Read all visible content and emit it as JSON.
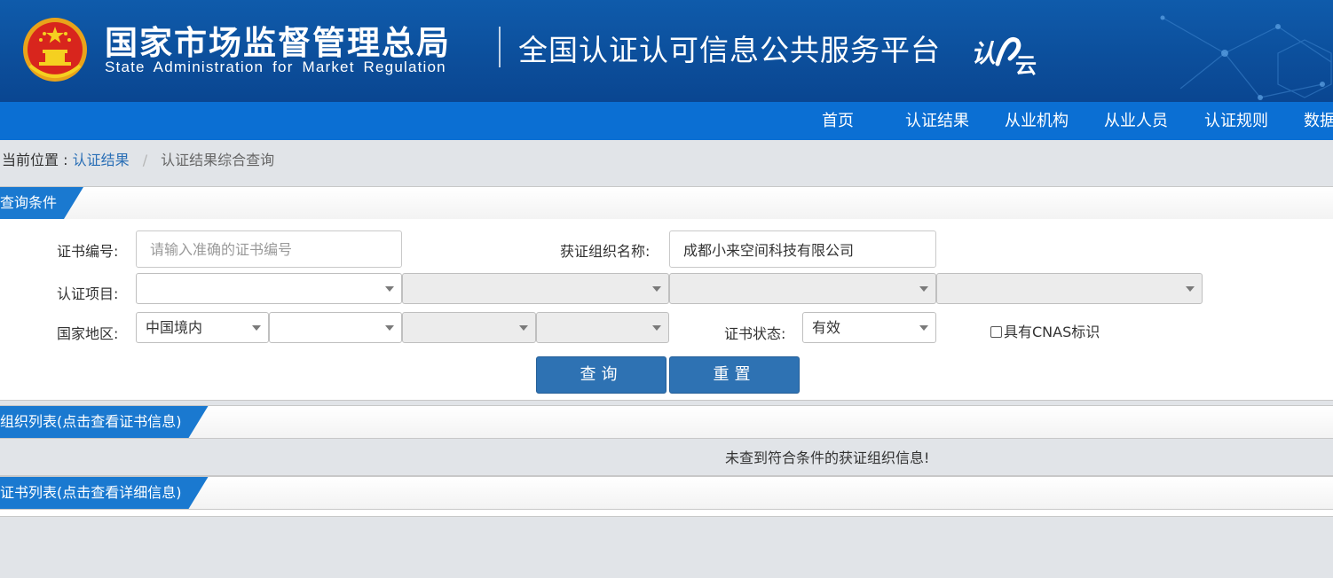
{
  "header": {
    "agency_cn": "国家市场监督管理总局",
    "agency_en": "State Administration for Market Regulation",
    "platform_title": "全国认证认可信息公共服务平台",
    "logo_text": "认证云",
    "emblem_icon": "national-emblem-icon"
  },
  "nav": {
    "items": [
      "首页",
      "认证结果",
      "从业机构",
      "从业人员",
      "认证规则",
      "数据"
    ]
  },
  "breadcrumb": {
    "prefix": "当前位置 :",
    "link": "认证结果",
    "separator": "/",
    "current": "认证结果综合查询"
  },
  "query_panel": {
    "title": "查询条件",
    "cert_no_label": "证书编号:",
    "cert_no_placeholder": "请输入准确的证书编号",
    "cert_no_value": "",
    "org_name_label": "获证组织名称:",
    "org_name_value": "成都小来空间科技有限公司",
    "project_label": "认证项目:",
    "project_selects": [
      "",
      "",
      "",
      ""
    ],
    "region_label": "国家地区:",
    "region_selects": [
      "中国境内",
      "",
      "",
      ""
    ],
    "status_label": "证书状态:",
    "status_value": "有效",
    "cnas_label": "具有CNAS标识",
    "search_button": "查询",
    "reset_button": "重置"
  },
  "org_list": {
    "title": "组织列表(点击查看证书信息)",
    "empty_message": "未查到符合条件的获证组织信息!"
  },
  "cert_list": {
    "title": "证书列表(点击查看详细信息)"
  },
  "colors": {
    "header_bg": "#0c4f9c",
    "nav_bg": "#0b6fd3",
    "panel_tab": "#1a79d0",
    "button_bg": "#2e72b3",
    "page_bg": "#e1e4e8",
    "link": "#2a6fb6"
  }
}
